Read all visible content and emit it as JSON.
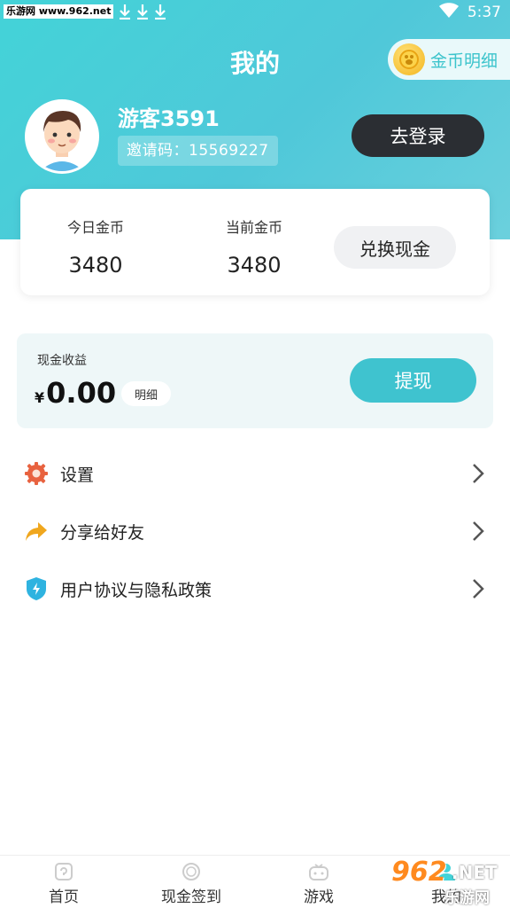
{
  "status_bar": {
    "watermark": "乐游网 www.962.net",
    "time": "5:37"
  },
  "header": {
    "title": "我的",
    "coin_detail_label": "金币明细"
  },
  "profile": {
    "username": "游客3591",
    "invite_label": "邀请码：",
    "invite_code": "15569227",
    "login_label": "去登录"
  },
  "coins": {
    "today_label": "今日金币",
    "today_value": "3480",
    "current_label": "当前金币",
    "current_value": "3480",
    "exchange_label": "兑换现金"
  },
  "cash": {
    "title": "现金收益",
    "symbol": "¥",
    "amount": "0.00",
    "detail_label": "明细",
    "withdraw_label": "提现"
  },
  "menu": {
    "items": [
      {
        "label": "设置",
        "icon": "gear-icon",
        "color": "#e8623f"
      },
      {
        "label": "分享给好友",
        "icon": "share-icon",
        "color": "#f0a71e"
      },
      {
        "label": "用户协议与隐私政策",
        "icon": "shield-icon",
        "color": "#2fb3e0"
      }
    ]
  },
  "tabs": [
    {
      "label": "首页",
      "icon": "home-icon"
    },
    {
      "label": "现金签到",
      "icon": "coin-sign-icon"
    },
    {
      "label": "游戏",
      "icon": "gamepad-icon"
    },
    {
      "label": "我的",
      "icon": "profile-icon"
    }
  ],
  "watermark_br": {
    "number": "962",
    "net": ".NET",
    "site": "乐游网"
  },
  "colors": {
    "accent": "#43d3d8",
    "withdraw": "#3fc3cf",
    "login_bg": "#2b2e33"
  }
}
